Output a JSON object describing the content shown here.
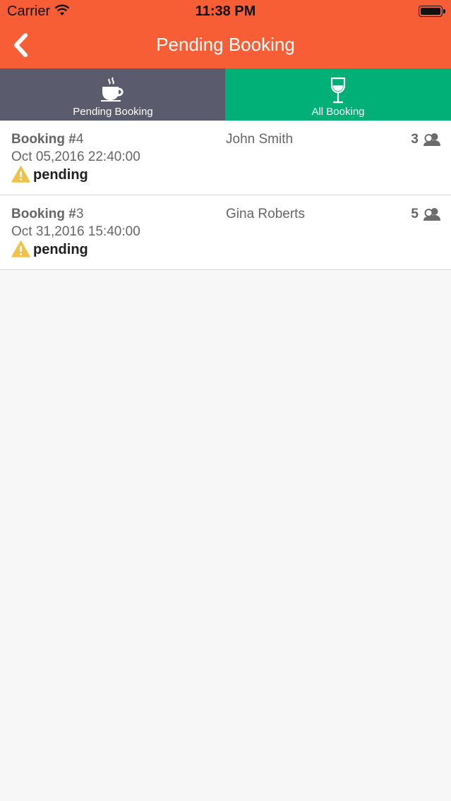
{
  "status_bar": {
    "carrier": "Carrier",
    "time": "11:38 PM"
  },
  "header": {
    "title": "Pending Booking",
    "back_icon": "chevron-left-icon",
    "background": "#f85e35"
  },
  "tabs": [
    {
      "label": "Pending Booking",
      "icon": "coffee-cup-icon",
      "background": "#5a5c6e"
    },
    {
      "label": "All Booking",
      "icon": "wine-glass-icon",
      "background": "#00b077"
    }
  ],
  "bookings": [
    {
      "booking_label": "Booking #",
      "number": "4",
      "datetime": "Oct 05,2016 22:40:00",
      "customer": "John Smith",
      "guests": "3",
      "status": "pending"
    },
    {
      "booking_label": "Booking #",
      "number": "3",
      "datetime": "Oct 31,2016 15:40:00",
      "customer": "Gina Roberts",
      "guests": "5",
      "status": "pending"
    }
  ],
  "colors": {
    "warning": "#f0c24a",
    "text": "#666666"
  }
}
